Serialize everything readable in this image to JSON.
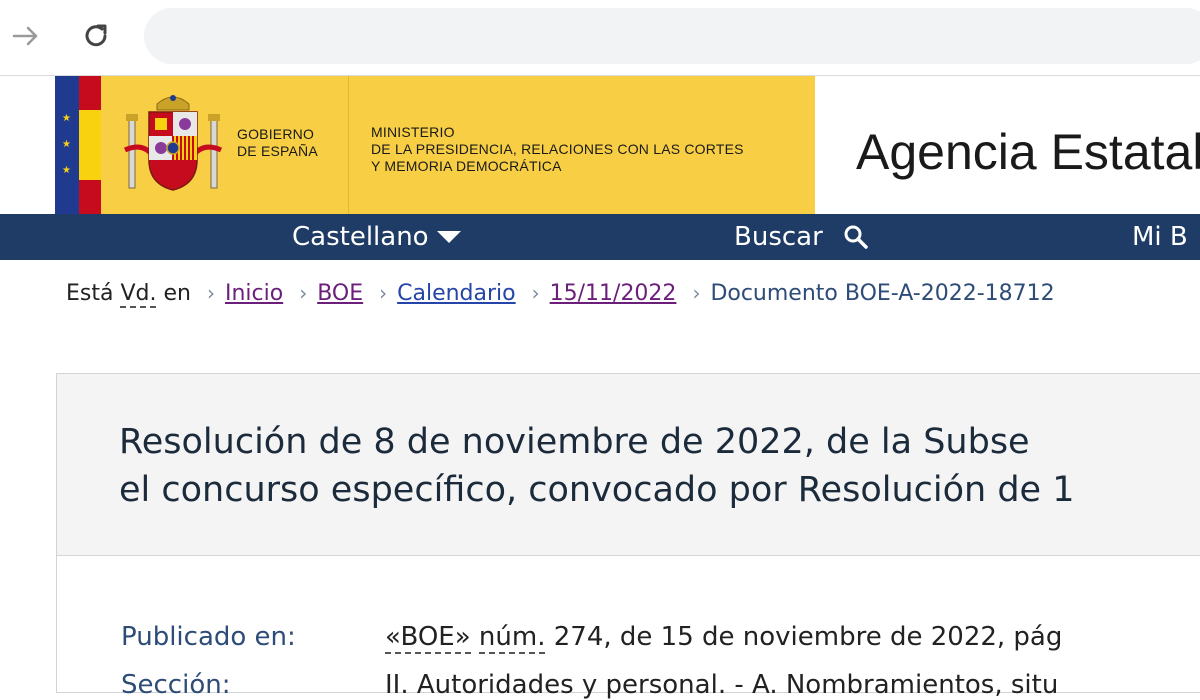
{
  "browser": {
    "forward_icon": "arrow-right-icon",
    "reload_icon": "reload-icon"
  },
  "header": {
    "gov_line1": "GOBIERNO",
    "gov_line2": "DE ESPAÑA",
    "ministry_line1": "MINISTERIO",
    "ministry_line2": "DE LA PRESIDENCIA, RELACIONES CON LAS CORTES",
    "ministry_line3": "Y MEMORIA DEMOCRÁTICA",
    "agency_title": "Agencia Estatal",
    "colors": {
      "gold": "#f8cf44",
      "navy": "#1f3c66",
      "flag_red": "#c60b1e",
      "flag_yellow": "#f8d10f",
      "eu_blue": "#1f3a8f"
    }
  },
  "nav": {
    "language": "Castellano",
    "search": "Buscar",
    "mi": "Mi B"
  },
  "breadcrumb": {
    "prefix_a": "Está ",
    "prefix_abbr": "Vd.",
    "prefix_b": " en",
    "items": [
      "Inicio",
      "BOE",
      "Calendario",
      "15/11/2022"
    ],
    "current": "Documento BOE-A-2022-18712"
  },
  "document": {
    "title_line1": "Resolución de 8 de noviembre de 2022, de la Subse",
    "title_line2": "el concurso específico, convocado por Resolución de 1",
    "published_label": "Publicado en:",
    "published_value_a": "«BOE»",
    "published_value_abbr": "núm.",
    "published_value_b": " 274, de 15 de noviembre de 2022, pág",
    "section_label": "Sección:",
    "section_value": "II. Autoridades y personal. - A. Nombramientos, situ"
  }
}
